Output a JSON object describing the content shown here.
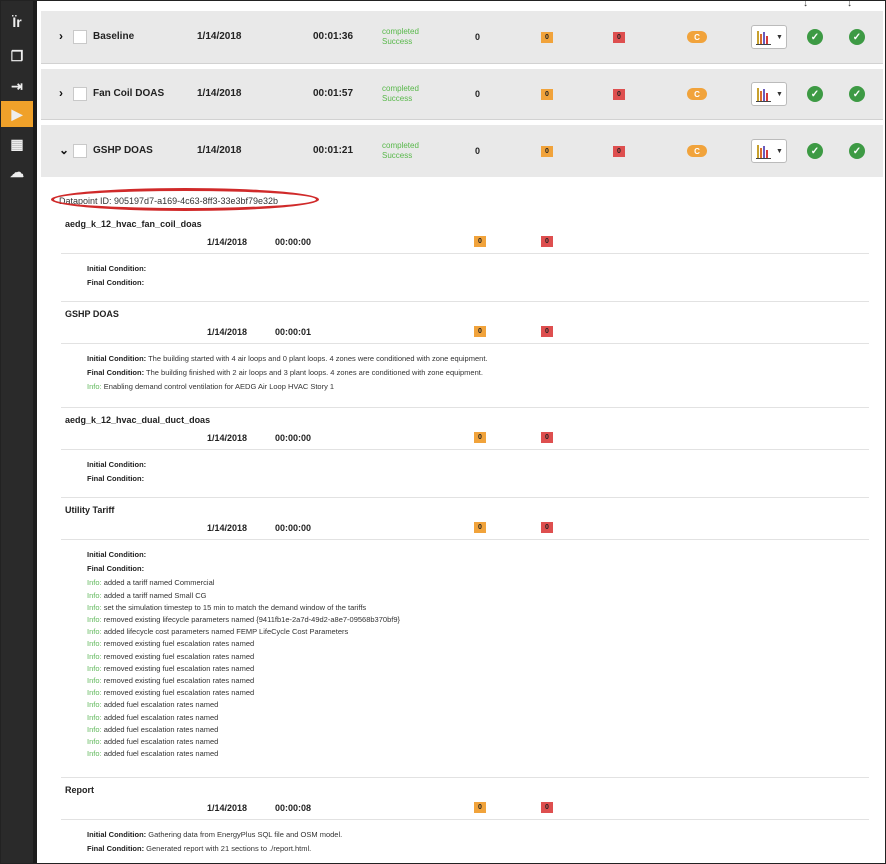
{
  "sidebar": {
    "items": [
      {
        "icon": "tools-icon",
        "glyph": "Ïr"
      },
      {
        "icon": "copy-icon",
        "glyph": "❐"
      },
      {
        "icon": "export-icon",
        "glyph": "⇥"
      },
      {
        "icon": "run-icon",
        "glyph": "▶",
        "active": true
      },
      {
        "icon": "results-icon",
        "glyph": "▦"
      },
      {
        "icon": "cloud-icon",
        "glyph": "☁"
      }
    ]
  },
  "runs": [
    {
      "name": "Baseline",
      "date": "1/14/2018",
      "duration": "00:01:36",
      "status1": "completed",
      "status2": "Success",
      "count": "0",
      "warnings": "0",
      "errors": "0",
      "c_label": "C",
      "expanded": false
    },
    {
      "name": "Fan Coil DOAS",
      "date": "1/14/2018",
      "duration": "00:01:57",
      "status1": "completed",
      "status2": "Success",
      "count": "0",
      "warnings": "0",
      "errors": "0",
      "c_label": "C",
      "expanded": false
    },
    {
      "name": "GSHP DOAS",
      "date": "1/14/2018",
      "duration": "00:01:21",
      "status1": "completed",
      "status2": "Success",
      "count": "0",
      "warnings": "0",
      "errors": "0",
      "c_label": "C",
      "expanded": true
    }
  ],
  "datapoint_id": "Datapoint ID: 905197d7-a169-4c63-8ff3-33e3bf79e32b",
  "steps": [
    {
      "name": "aedg_k_12_hvac_fan_coil_doas",
      "date": "1/14/2018",
      "time": "00:00:00",
      "warnings": "0",
      "errors": "0",
      "initial_label": "Initial Condition:",
      "initial_text": "",
      "final_label": "Final Condition:",
      "final_text": "",
      "infos": []
    },
    {
      "name": "GSHP DOAS",
      "date": "1/14/2018",
      "time": "00:00:01",
      "warnings": "0",
      "errors": "0",
      "initial_label": "Initial Condition:",
      "initial_text": " The building started with 4 air loops and 0 plant loops. 4 zones were conditioned with zone equipment.",
      "final_label": "Final Condition:",
      "final_text": " The building finished with 2 air loops and 3 plant loops. 4 zones are conditioned with zone equipment.",
      "infos": [
        "Enabling demand control ventilation for AEDG Air Loop HVAC Story 1"
      ]
    },
    {
      "name": "aedg_k_12_hvac_dual_duct_doas",
      "date": "1/14/2018",
      "time": "00:00:00",
      "warnings": "0",
      "errors": "0",
      "initial_label": "Initial Condition:",
      "initial_text": "",
      "final_label": "Final Condition:",
      "final_text": "",
      "infos": []
    },
    {
      "name": "Utility Tariff",
      "date": "1/14/2018",
      "time": "00:00:00",
      "warnings": "0",
      "errors": "0",
      "initial_label": "Initial Condition:",
      "initial_text": "",
      "final_label": "Final Condition:",
      "final_text": "",
      "infos": [
        "added a tariff named Commercial",
        "added a tariff named Small CG",
        "set the simulation timestep to 15 min to match the demand window of the tariffs",
        "removed existing lifecycle parameters named {9411fb1e-2a7d-49d2-a8e7-09568b370bf9}",
        "added lifecycle cost parameters named FEMP LifeCycle Cost Parameters",
        "removed existing fuel escalation rates named",
        "removed existing fuel escalation rates named",
        "removed existing fuel escalation rates named",
        "removed existing fuel escalation rates named",
        "removed existing fuel escalation rates named",
        "added fuel escalation rates named",
        "added fuel escalation rates named",
        "added fuel escalation rates named",
        "added fuel escalation rates named",
        "added fuel escalation rates named"
      ]
    },
    {
      "name": "Report",
      "date": "1/14/2018",
      "time": "00:00:08",
      "warnings": "0",
      "errors": "0",
      "initial_label": "Initial Condition:",
      "initial_text": " Gathering data from EnergyPlus SQL file and OSM model.",
      "final_label": "Final Condition:",
      "final_text": " Generated report with 21 sections to ./report.html.",
      "infos": []
    }
  ],
  "info_label": "Info:",
  "colors": {
    "sidebar": "#2a2a2a",
    "accent": "#f0a12a",
    "success_green": "#58b84a",
    "check_green": "#3d9a44",
    "error_red": "#de4f4f",
    "highlight_oval": "#d02a2a"
  }
}
